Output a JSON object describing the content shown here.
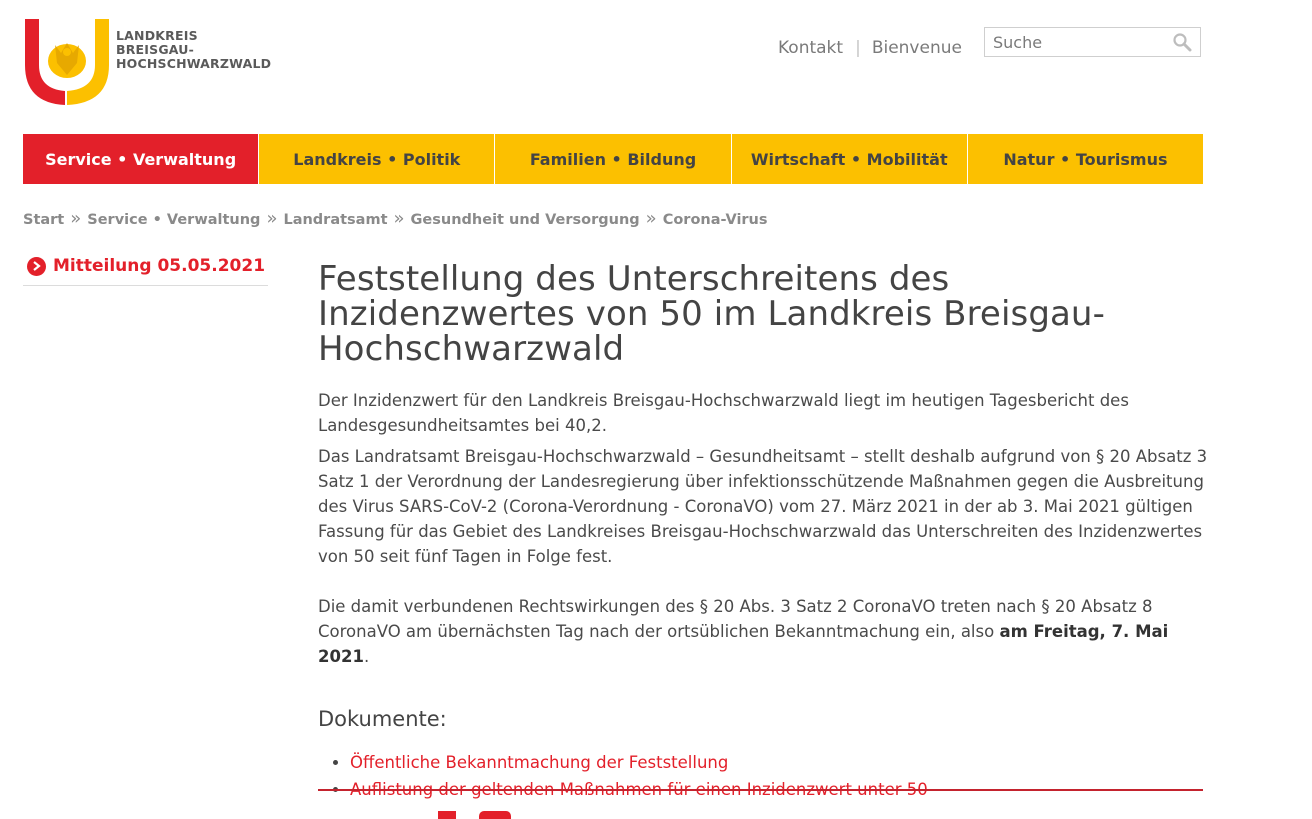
{
  "header": {
    "logo_lines": [
      "LANDKREIS",
      "BREISGAU-",
      "HOCHSCHWARZWALD"
    ],
    "links": [
      {
        "label": "Kontakt"
      },
      {
        "label": "Bienvenue"
      }
    ],
    "link_separator": "|",
    "search_placeholder": "Suche"
  },
  "nav": {
    "items": [
      {
        "label": "Service • Verwaltung",
        "active": true
      },
      {
        "label": "Landkreis • Politik"
      },
      {
        "label": "Familien • Bildung"
      },
      {
        "label": "Wirtschaft • Mobilität"
      },
      {
        "label": "Natur • Tourismus"
      }
    ]
  },
  "breadcrumb": {
    "items": [
      "Start",
      "Service • Verwaltung",
      "Landratsamt",
      "Gesundheit und Versorgung",
      "Corona-Virus"
    ],
    "separator": "»"
  },
  "sidebar": {
    "items": [
      {
        "label": "Mitteilung 05.05.2021"
      }
    ]
  },
  "article": {
    "title": "Feststellung des Unterschreitens des Inzidenzwertes von 50 im Landkreis Breisgau-Hochschwarzwald",
    "p1": "Der Inzidenzwert für den Landkreis Breisgau-Hochschwarzwald liegt im heutigen Tagesbericht des Landesgesundheitsamtes bei 40,2.",
    "p2": "Das Landratsamt Breisgau-Hochschwarzwald – Gesundheitsamt – stellt deshalb aufgrund von § 20 Absatz 3 Satz 1 der Verordnung der Landesregierung über infektionsschützende Maßnahmen gegen die Ausbreitung des Virus SARS-CoV-2 (Corona-Verordnung - CoronaVO) vom 27. März 2021 in der ab 3. Mai 2021 gültigen Fassung für das Gebiet des Landkreises Breisgau-Hochschwarzwald das Unterschreiten des Inzidenzwertes von 50 seit fünf Tagen in Folge fest.",
    "p3_before": "Die damit verbundenen Rechtswirkungen des § 20 Abs. 3 Satz 2 CoronaVO treten nach § 20 Absatz 8 CoronaVO am übernächsten Tag nach der ortsüblichen Bekanntmachung ein, also ",
    "p3_bold": "am Freitag, 7. Mai 2021",
    "p3_after": ".",
    "documents_heading": "Dokumente:",
    "documents": [
      {
        "label": "Öffentliche Bekanntmachung der Feststellung"
      },
      {
        "label": "Auflistung der geltenden Maßnahmen für einen Inzidenzwert unter 50"
      }
    ]
  },
  "colors": {
    "brand_red": "#e3202a",
    "brand_yellow": "#fcc000"
  }
}
